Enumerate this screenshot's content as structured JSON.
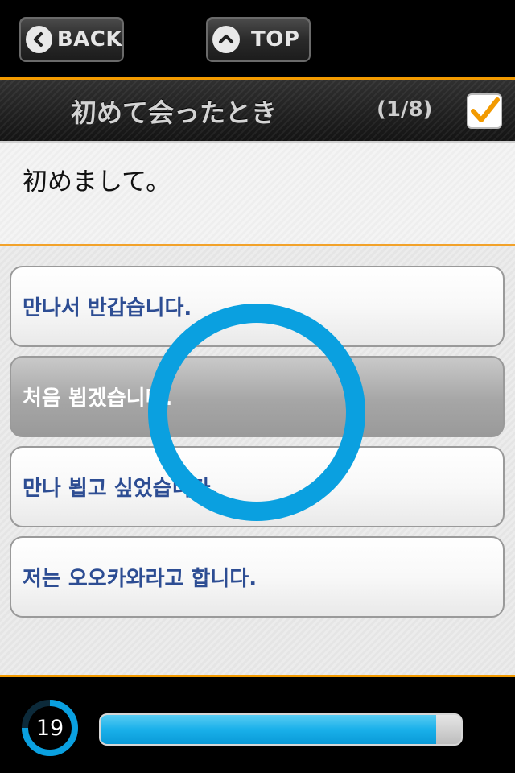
{
  "toolbar": {
    "back_label": "BACK",
    "top_label": "TOP"
  },
  "header": {
    "title": "初めて会ったとき",
    "counter": "(1/8)",
    "checked": true
  },
  "question": {
    "text": "初めまして。"
  },
  "options": [
    {
      "text": "만나서 반갑습니다."
    },
    {
      "text": "처음 뵙겠습니다.",
      "selected": true
    },
    {
      "text": "만나 뵙고 싶었습니다."
    },
    {
      "text": "저는 오오카와라고 합니다."
    }
  ],
  "status": {
    "timer": "19",
    "progress": 0.93
  },
  "colors": {
    "accent": "#f29a00",
    "blue": "#0aa0e0",
    "option_text": "#2d4d93"
  },
  "icons": [
    "chevron-left-icon",
    "chevron-up-icon",
    "checkmark-icon",
    "circle-correct-icon"
  ]
}
